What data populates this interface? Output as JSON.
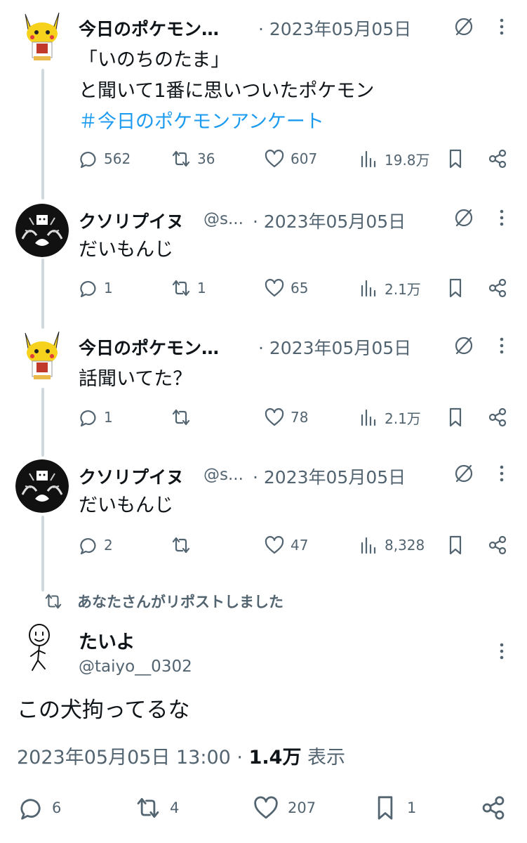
{
  "tweets": [
    {
      "display_name": "今日のポケモン…",
      "handle": "",
      "date": "· 2023年05月05日",
      "text_lines": [
        "「いのちのたま」",
        "と聞いて1番に思いついたポケモン"
      ],
      "hashtag": "＃今日のポケモンアンケート",
      "stats": {
        "replies": "562",
        "reposts": "36",
        "likes": "607",
        "views": "19.8万"
      }
    },
    {
      "display_name": "クソリプイヌ",
      "handle": "@s...",
      "date": "· 2023年05月05日",
      "text_lines": [
        "だいもんじ"
      ],
      "stats": {
        "replies": "1",
        "reposts": "1",
        "likes": "65",
        "views": "2.1万"
      }
    },
    {
      "display_name": "今日のポケモン…",
      "handle": "",
      "date": "· 2023年05月05日",
      "text_lines": [
        "話聞いてた？"
      ],
      "stats": {
        "replies": "1",
        "reposts": "",
        "likes": "78",
        "views": "2.1万"
      }
    },
    {
      "display_name": "クソリプイヌ",
      "handle": "@s...",
      "date": "· 2023年05月05日",
      "text_lines": [
        "だいもんじ"
      ],
      "stats": {
        "replies": "2",
        "reposts": "",
        "likes": "47",
        "views": "8,328"
      }
    }
  ],
  "repost_note": "あなたさんがリポストしました",
  "main_tweet": {
    "display_name": "たいよ",
    "handle": "@taiyo__0302",
    "text": "この犬拘ってるな",
    "timestamp": "2023年05月05日 13:00",
    "separator": "·",
    "views_count": "1.4万",
    "views_label": "表示",
    "stats": {
      "replies": "6",
      "reposts": "4",
      "likes": "207",
      "bookmarks": "1"
    }
  },
  "colors": {
    "text": "#0f1419",
    "muted": "#536471",
    "link": "#1d9bf0",
    "thread_line": "#cfd9de"
  }
}
